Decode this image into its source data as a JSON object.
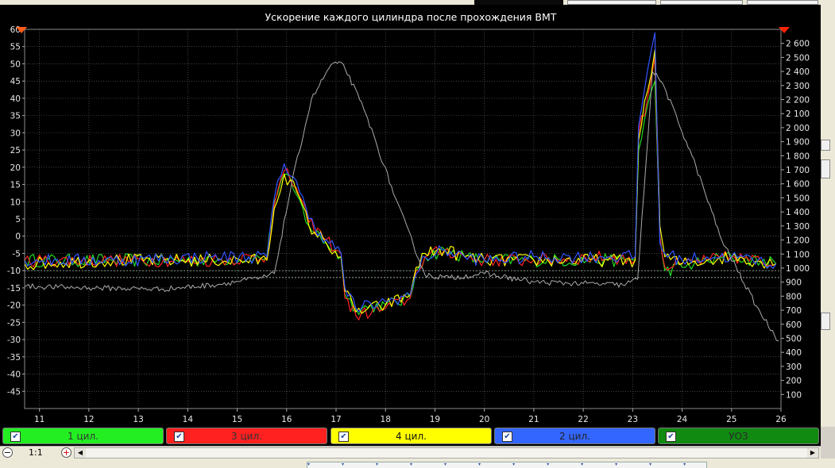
{
  "chart_data": {
    "type": "line",
    "title": "Ускорение каждого цилиндра после прохождения ВМТ",
    "x": {
      "range": [
        10.7,
        26.0
      ],
      "ticks": [
        11,
        12,
        13,
        14,
        15,
        16,
        17,
        18,
        19,
        20,
        21,
        22,
        23,
        24,
        25,
        26
      ]
    },
    "y_left": {
      "range": [
        -50,
        60
      ],
      "ticks": [
        60,
        55,
        50,
        45,
        40,
        35,
        30,
        25,
        20,
        15,
        10,
        5,
        0,
        -5,
        -10,
        -15,
        -20,
        -25,
        -30,
        -35,
        -40,
        -45
      ]
    },
    "y_right": {
      "range": [
        0,
        2700
      ],
      "ticks": [
        2600,
        2500,
        2400,
        2300,
        2200,
        2100,
        2000,
        1900,
        1800,
        1700,
        1600,
        1500,
        1400,
        1300,
        1200,
        1100,
        1000,
        900,
        800,
        700,
        600,
        500,
        400,
        300,
        200,
        100
      ],
      "tick_labels": [
        "2 600",
        "2 500",
        "2 400",
        "2 300",
        "2 200",
        "2 100",
        "2 000",
        "1 900",
        "1 800",
        "1 700",
        "1 600",
        "1 500",
        "1 400",
        "1 300",
        "1 200",
        "1 100",
        "1 000",
        "900",
        "800",
        "700",
        "600",
        "500",
        "400",
        "300",
        "200",
        "100"
      ]
    },
    "reference_lines_left": [
      -10,
      -12
    ],
    "grid": true,
    "noise": 1.2,
    "series": [
      {
        "name": "1 цил.",
        "color": "#22dd22",
        "axis": "left",
        "points": [
          [
            10.7,
            -7
          ],
          [
            12.5,
            -7
          ],
          [
            14.5,
            -7
          ],
          [
            15.6,
            -6
          ],
          [
            15.75,
            10
          ],
          [
            15.95,
            18
          ],
          [
            16.2,
            12
          ],
          [
            16.45,
            3
          ],
          [
            16.8,
            -2
          ],
          [
            17.1,
            -6
          ],
          [
            17.18,
            -17
          ],
          [
            17.4,
            -21
          ],
          [
            18.0,
            -20
          ],
          [
            18.5,
            -18
          ],
          [
            18.62,
            -10
          ],
          [
            18.8,
            -6
          ],
          [
            19.2,
            -4
          ],
          [
            19.6,
            -6
          ],
          [
            20,
            -7
          ],
          [
            21,
            -7
          ],
          [
            22.5,
            -7
          ],
          [
            23.05,
            -7
          ],
          [
            23.12,
            25
          ],
          [
            23.3,
            38
          ],
          [
            23.45,
            45
          ],
          [
            23.55,
            0
          ],
          [
            23.65,
            -10
          ],
          [
            24.0,
            -9
          ],
          [
            24.5,
            -7
          ],
          [
            25.0,
            -6
          ],
          [
            25.9,
            -8
          ]
        ]
      },
      {
        "name": "3 цил.",
        "color": "#ff2222",
        "axis": "left",
        "points": [
          [
            10.7,
            -7
          ],
          [
            12.5,
            -7
          ],
          [
            14.5,
            -7
          ],
          [
            15.6,
            -6
          ],
          [
            15.75,
            9
          ],
          [
            15.95,
            19
          ],
          [
            16.2,
            14
          ],
          [
            16.45,
            4
          ],
          [
            16.8,
            -1
          ],
          [
            17.1,
            -5
          ],
          [
            17.18,
            -18
          ],
          [
            17.4,
            -23
          ],
          [
            18.0,
            -21
          ],
          [
            18.5,
            -18
          ],
          [
            18.62,
            -10
          ],
          [
            18.8,
            -6
          ],
          [
            19.2,
            -4
          ],
          [
            19.6,
            -6
          ],
          [
            20,
            -7
          ],
          [
            21,
            -7
          ],
          [
            22.5,
            -6
          ],
          [
            23.05,
            -7
          ],
          [
            23.12,
            30
          ],
          [
            23.3,
            40
          ],
          [
            23.45,
            52
          ],
          [
            23.55,
            0
          ],
          [
            23.65,
            -9
          ],
          [
            24.0,
            -8
          ],
          [
            24.5,
            -7
          ],
          [
            25.0,
            -6
          ],
          [
            25.9,
            -8
          ]
        ]
      },
      {
        "name": "4 цил.",
        "color": "#ffff00",
        "axis": "left",
        "points": [
          [
            10.7,
            -8
          ],
          [
            12.5,
            -7
          ],
          [
            14.5,
            -7
          ],
          [
            15.6,
            -7
          ],
          [
            15.75,
            8
          ],
          [
            15.95,
            18
          ],
          [
            16.2,
            13
          ],
          [
            16.45,
            3
          ],
          [
            16.8,
            -2
          ],
          [
            17.1,
            -6
          ],
          [
            17.18,
            -16
          ],
          [
            17.4,
            -22
          ],
          [
            18.0,
            -20
          ],
          [
            18.5,
            -17
          ],
          [
            18.62,
            -9
          ],
          [
            18.8,
            -5
          ],
          [
            19.2,
            -4
          ],
          [
            19.6,
            -6
          ],
          [
            20,
            -7
          ],
          [
            21,
            -7
          ],
          [
            22.5,
            -7
          ],
          [
            23.05,
            -7
          ],
          [
            23.12,
            28
          ],
          [
            23.3,
            42
          ],
          [
            23.45,
            54
          ],
          [
            23.55,
            3
          ],
          [
            23.65,
            -6
          ],
          [
            24.0,
            -8
          ],
          [
            24.5,
            -7
          ],
          [
            25.0,
            -6
          ],
          [
            25.9,
            -8
          ]
        ]
      },
      {
        "name": "2 цил.",
        "color": "#3355ff",
        "axis": "left",
        "points": [
          [
            10.7,
            -7
          ],
          [
            12.5,
            -7
          ],
          [
            14.5,
            -6
          ],
          [
            15.6,
            -6
          ],
          [
            15.75,
            11
          ],
          [
            15.95,
            21
          ],
          [
            16.2,
            16
          ],
          [
            16.45,
            5
          ],
          [
            16.8,
            -1
          ],
          [
            17.1,
            -5
          ],
          [
            17.18,
            -15
          ],
          [
            17.4,
            -21
          ],
          [
            18.0,
            -19
          ],
          [
            18.5,
            -17
          ],
          [
            18.62,
            -11
          ],
          [
            18.8,
            -6
          ],
          [
            19.2,
            -4
          ],
          [
            19.6,
            -6
          ],
          [
            20,
            -7
          ],
          [
            21,
            -6
          ],
          [
            22.5,
            -6
          ],
          [
            23.05,
            -6
          ],
          [
            23.12,
            32
          ],
          [
            23.3,
            48
          ],
          [
            23.45,
            59
          ],
          [
            23.55,
            -2
          ],
          [
            23.65,
            -5
          ],
          [
            24.0,
            -7
          ],
          [
            24.5,
            -6
          ],
          [
            25.0,
            -6
          ],
          [
            25.9,
            -8
          ]
        ]
      },
      {
        "name": "УОЗ",
        "color": "#aaaaaa",
        "axis": "right",
        "points": [
          [
            10.7,
            870
          ],
          [
            12.0,
            860
          ],
          [
            13.5,
            850
          ],
          [
            14.5,
            880
          ],
          [
            15.5,
            930
          ],
          [
            15.75,
            960
          ],
          [
            16.1,
            1600
          ],
          [
            16.5,
            2200
          ],
          [
            16.9,
            2450
          ],
          [
            17.15,
            2450
          ],
          [
            17.6,
            2100
          ],
          [
            18.2,
            1500
          ],
          [
            18.8,
            950
          ],
          [
            19.3,
            930
          ],
          [
            20,
            960
          ],
          [
            21,
            900
          ],
          [
            22,
            890
          ],
          [
            22.8,
            880
          ],
          [
            23.1,
            920
          ],
          [
            23.4,
            2400
          ],
          [
            23.6,
            2320
          ],
          [
            24.2,
            1800
          ],
          [
            24.8,
            1200
          ],
          [
            25.5,
            730
          ],
          [
            25.95,
            480
          ]
        ]
      }
    ]
  },
  "legend": [
    {
      "label": "1 цил.",
      "color": "#22ee22",
      "text_color": "#333333",
      "checked": true
    },
    {
      "label": "3 цил.",
      "color": "#ff2020",
      "text_color": "#333333",
      "checked": true
    },
    {
      "label": "4 цил.",
      "color": "#ffff00",
      "text_color": "#111111",
      "checked": true
    },
    {
      "label": "2 цил.",
      "color": "#3366ff",
      "text_color": "#222222",
      "checked": true
    },
    {
      "label": "УОЗ",
      "color": "#108a10",
      "text_color": "#2a2a2a",
      "checked": true
    }
  ],
  "zoom": {
    "label": "1:1"
  }
}
